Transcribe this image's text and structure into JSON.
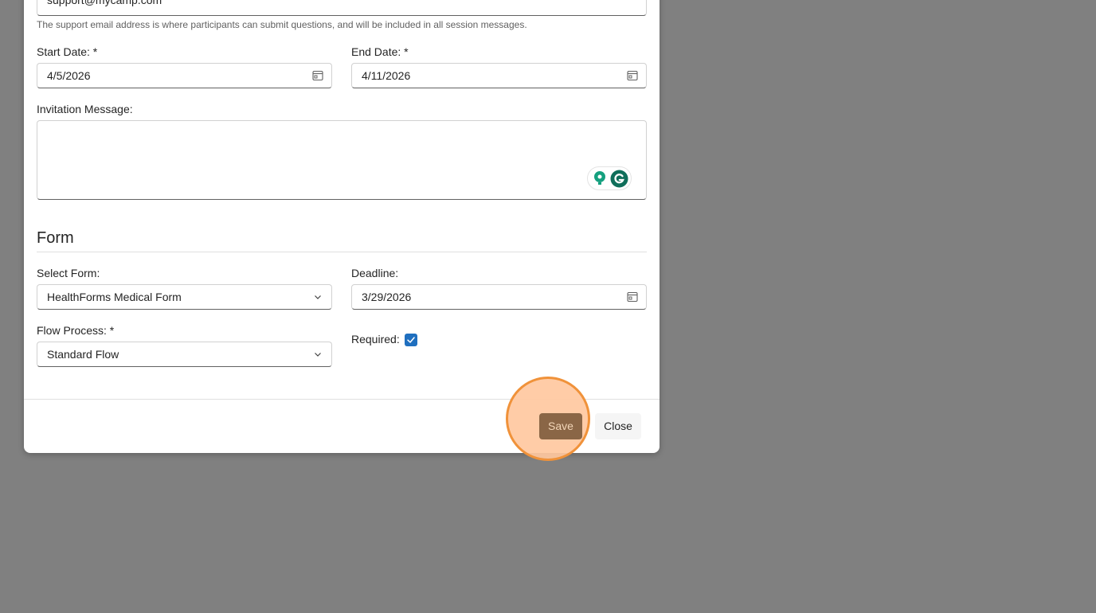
{
  "dialog": {
    "support_email": {
      "value": "support@mycamp.com",
      "hint": "The support email address is where participants can submit questions, and will be included in all session messages."
    },
    "start_date": {
      "label": "Start Date: *",
      "value": "4/5/2026"
    },
    "end_date": {
      "label": "End Date: *",
      "value": "4/11/2026"
    },
    "invitation_message": {
      "label": "Invitation Message:",
      "value": ""
    },
    "form_section": {
      "title": "Form",
      "select_form": {
        "label": "Select Form:",
        "value": "HealthForms Medical Form"
      },
      "deadline": {
        "label": "Deadline:",
        "value": "3/29/2026"
      },
      "flow_process": {
        "label": "Flow Process: *",
        "value": "Standard Flow"
      },
      "required": {
        "label": "Required:",
        "checked": true
      }
    },
    "footer": {
      "save_label": "Save",
      "close_label": "Close"
    }
  },
  "colors": {
    "backdrop": "#808080",
    "save_button": "#8a6646",
    "checkbox": "#1f6fbf",
    "highlight": "#f0923a"
  },
  "icons": [
    "calendar-icon",
    "chevron-down-icon",
    "checkmark-icon",
    "grammarly-icon",
    "lightbulb-icon"
  ]
}
